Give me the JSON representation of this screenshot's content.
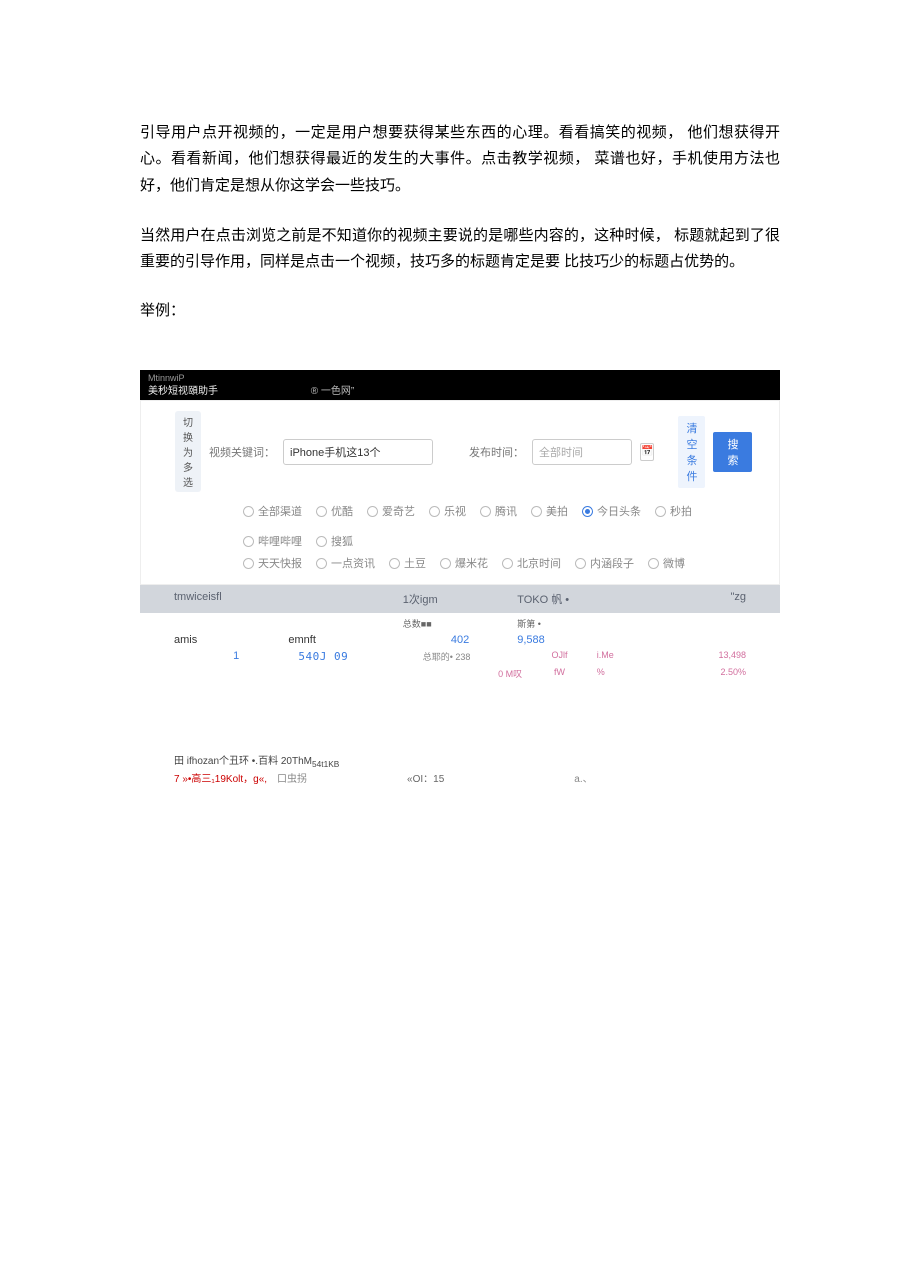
{
  "paragraphs": {
    "p1": "引导用户点开视频的，一定是用户想要获得某些东西的心理。看看搞笑的视频， 他们想获得开心。看看新闻，他们想获得最近的发生的大事件。点击教学视频， 菜谱也好，手机使用方法也好，他们肯定是想从你这学会一些技巧。",
    "p2": "当然用户在点击浏览之前是不知道你的视频主要说的是哪些内容的，这种时候， 标题就起到了很重要的引导作用，同样是点击一个视频，技巧多的标题肯定是要 比技巧少的标题占优势的。",
    "example_label": "举例："
  },
  "blackbar": {
    "row1": "MtinnwiP",
    "row2_left": "美秒短视頤助手",
    "row2_right": "® 一色网”"
  },
  "filter": {
    "switch_label": "切换为多选",
    "keyword_label": "视频关键词：",
    "keyword_value": "iPhone手机这13个",
    "time_label": "发布时间：",
    "time_value": "全部时间",
    "clear_label": "清空条件",
    "search_label": "搜索",
    "radio_row1": [
      "全部渠道",
      "优酷",
      "爱奇艺",
      "乐视",
      "腾讯",
      "美拍",
      "今日头条",
      "秒拍",
      "哔哩哔哩",
      "搜狐"
    ],
    "checked": "今日头条",
    "radio_row2": [
      "天天快报",
      "一点资讯",
      "土豆",
      "爆米花",
      "北京时间",
      "内涵段子",
      "微博"
    ]
  },
  "table": {
    "th1": "tmwiceisfl",
    "th2": "1次igm",
    "th3": "TOKO 帆 •",
    "th4": "\"zg",
    "sub2": "总数■■",
    "sub3": "斯第 •",
    "r1c1": "amis",
    "r1c2": "emnft",
    "r1c3": "402",
    "r1c4": "9,588",
    "r2c1": "1",
    "r2c2": "540J 09",
    "r2mid": "总耶的• 238",
    "r2c3": "OJlf",
    "r2c4": "i.Me",
    "r2c5": "13,498",
    "r3mid": "0 M叹",
    "r3c3": "fW",
    "r3c4": "%",
    "r3c5": "2.50%"
  },
  "footer": {
    "line1_a": "田 ifhozan个丑环 •.百料",
    "line1_b": "20ThM",
    "line1_c": "54t1KB",
    "line2_a": "7 »•高三₁19Kolt，g«,",
    "line2_b": "口虫拐",
    "line2_c": "«OI：15",
    "line2_d": "a.、"
  }
}
